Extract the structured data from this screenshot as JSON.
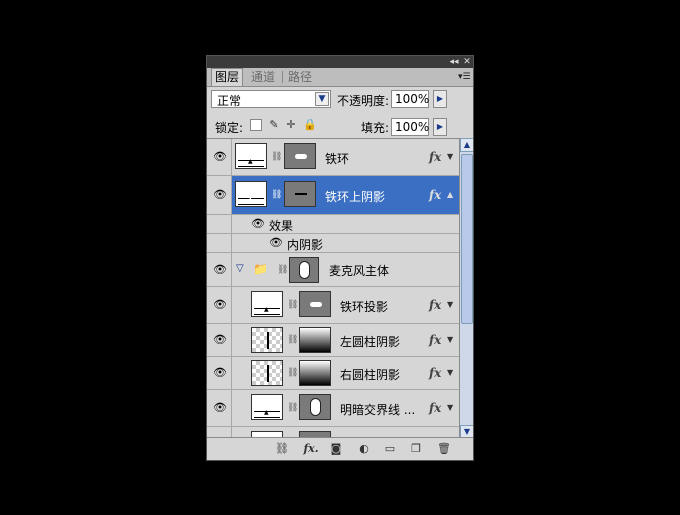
{
  "titlebar": {
    "collapse_icon": "double-chevron-left-icon",
    "close_icon": "close-icon"
  },
  "tabs": [
    {
      "label": "图层",
      "active": true
    },
    {
      "label": "通道",
      "active": false
    },
    {
      "label": "路径",
      "active": false
    }
  ],
  "blend": {
    "mode": "正常",
    "opacity_label": "不透明度:",
    "opacity_value": "100%"
  },
  "lock": {
    "label": "锁定:",
    "fill_label": "填充:",
    "fill_value": "100%"
  },
  "layers": [
    {
      "name": "铁环",
      "fx": "fx",
      "selected": false
    },
    {
      "name": "铁环上阴影",
      "fx": "fx",
      "selected": true
    },
    {
      "name": "效果",
      "kind": "effects-header"
    },
    {
      "name": "内阴影",
      "kind": "effect"
    },
    {
      "name": "麦克风主体",
      "kind": "group"
    },
    {
      "name": "铁环投影",
      "fx": "fx"
    },
    {
      "name": "左圆柱阴影",
      "fx": "fx"
    },
    {
      "name": "右圆柱阴影",
      "fx": "fx"
    },
    {
      "name": "明暗交界线 ...",
      "fx": "fx"
    }
  ],
  "bottom": {
    "fx_label": "fx."
  },
  "colors": {
    "selected": "#3a6fc4",
    "panel": "#d6d6d6"
  }
}
